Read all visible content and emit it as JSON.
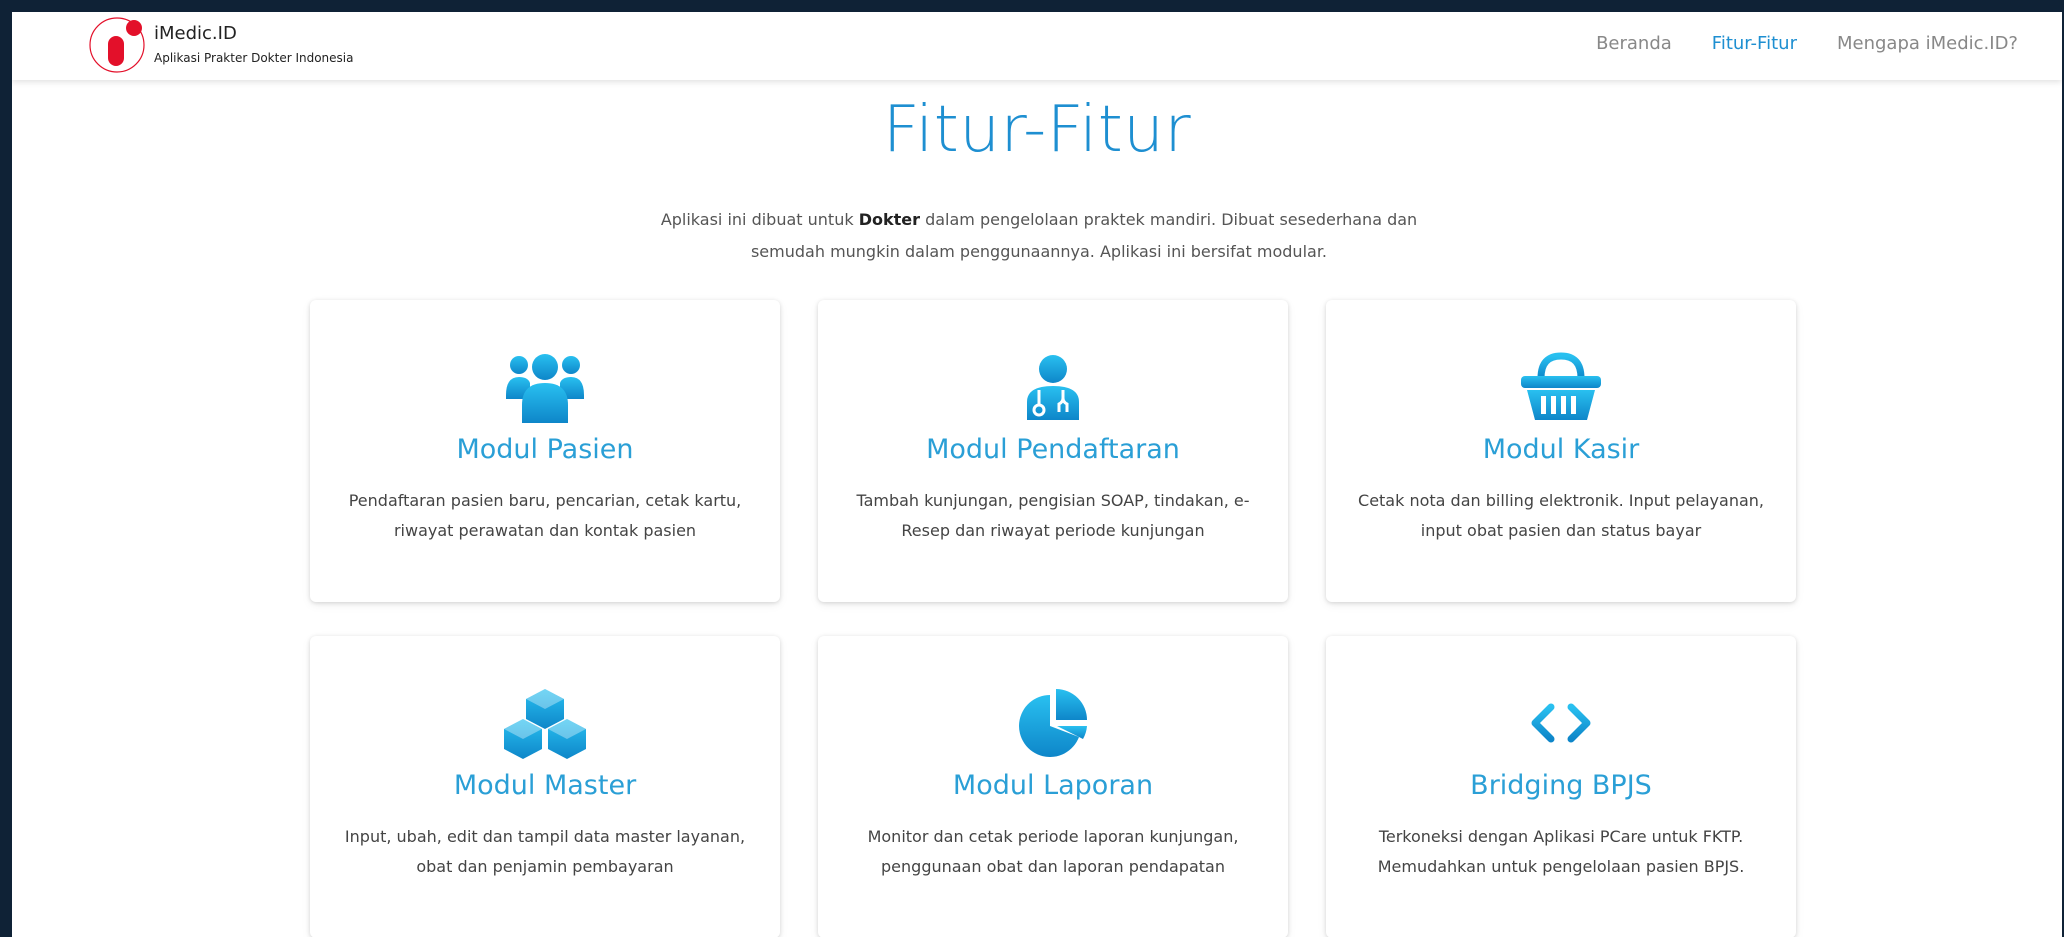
{
  "brand": {
    "name": "iMedic.ID",
    "tagline": "Aplikasi Prakter Dokter Indonesia"
  },
  "nav": {
    "items": [
      "Beranda",
      "Fitur-Fitur",
      "Mengapa iMedic.ID?"
    ],
    "active": "Fitur-Fitur"
  },
  "hero": {
    "title": "Fitur-Fitur",
    "intro_before": "Aplikasi ini dibuat untuk ",
    "intro_bold": "Dokter",
    "intro_after": " dalam pengelolaan praktek mandiri. Dibuat sesederhana dan semudah mungkin dalam penggunaannya. Aplikasi ini bersifat modular."
  },
  "colors": {
    "accent": "#1e8fd1",
    "icon_gradient_top": "#29c0f0",
    "icon_gradient_bottom": "#0e86c9",
    "logo_red": "#e3102a"
  },
  "features": [
    {
      "icon": "users-icon",
      "title": "Modul Pasien",
      "desc": "Pendaftaran pasien baru, pencarian, cetak kartu, riwayat perawatan dan kontak pasien"
    },
    {
      "icon": "doctor-icon",
      "title": "Modul Pendaftaran",
      "desc": "Tambah kunjungan, pengisian SOAP, tindakan, e-Resep dan riwayat periode kunjungan"
    },
    {
      "icon": "basket-icon",
      "title": "Modul Kasir",
      "desc": "Cetak nota dan billing elektronik. Input pelayanan, input obat pasien dan status bayar"
    },
    {
      "icon": "cubes-icon",
      "title": "Modul Master",
      "desc": "Input, ubah, edit dan tampil data master layanan, obat dan penjamin pembayaran"
    },
    {
      "icon": "pie-chart-icon",
      "title": "Modul Laporan",
      "desc": "Monitor dan cetak periode laporan kunjungan, penggunaan obat dan laporan pendapatan"
    },
    {
      "icon": "code-icon",
      "title": "Bridging BPJS",
      "desc": "Terkoneksi dengan Aplikasi PCare untuk FKTP. Memudahkan untuk pengelolaan pasien BPJS."
    }
  ]
}
